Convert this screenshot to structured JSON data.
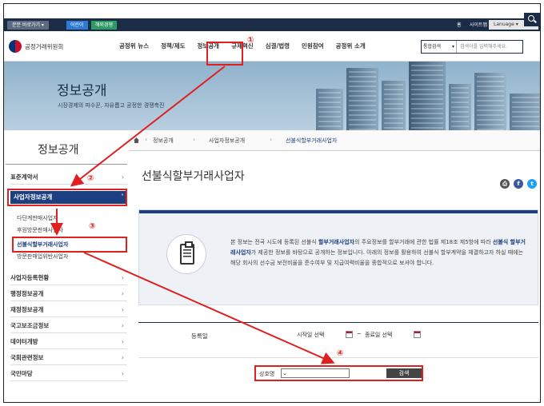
{
  "topbar": {
    "quick_label": "분문 바로가기 ▾",
    "kids": "어린이",
    "eco": "해외경쟁",
    "home": "홈",
    "sitemap": "사이트맵",
    "language": "Lanuage ▾"
  },
  "header": {
    "logo_text": "공정거래위원회",
    "nav": [
      "공정위 뉴스",
      "정책/제도",
      "정보공개",
      "규제혁신",
      "심결/법령",
      "민원참여",
      "공정위 소개"
    ],
    "search_scope": "통합검색",
    "search_placeholder": "검색어를 입력해주세요."
  },
  "banner": {
    "title": "정보공개",
    "subtitle": "시장경제의 파수꾼, 자유롭고 공정한 경쟁촉진"
  },
  "sidebar": {
    "title": "정보공개",
    "items": [
      {
        "label": "표준계약서"
      },
      {
        "label": "사업자정보공개"
      },
      {
        "label": "사업자등록현황"
      },
      {
        "label": "행정정보공개"
      },
      {
        "label": "재정정보공개"
      },
      {
        "label": "국고보조금정보"
      },
      {
        "label": "데이터개방"
      },
      {
        "label": "국회관련정보"
      },
      {
        "label": "국민마당"
      }
    ],
    "sub_items": [
      "다단계판매사업자",
      "후원방문판매사업자",
      "선불식할부거래사업자",
      "방문판매업위반사업자"
    ]
  },
  "breadcrumb": [
    "정보공개",
    "사업자정보공개",
    "선불식할부거래사업자"
  ],
  "content": {
    "title": "선불식할부거래사업자",
    "info_parts": [
      "본 정보는 전국 시도에 등록된 선불식 ",
      "할부거래사업자",
      "의 주요정보를 할부거래에 관한 법률 제18조 제5항에 따라 ",
      "선불식 할부거래사업자",
      "가 제공한 정보를 바탕으로 공개하는 정보입니다. 아래의 정보를 활용하여 선불식 할부계약을 체결하고자 하실 때에는 해당 회사의 선수금 보전비율을 준수여부 및 지급여력비율을 종합적으로 보셔야 합니다."
    ]
  },
  "form": {
    "reg_date_label": "등록일",
    "start_date": "시작일 선택",
    "end_date": "종료일 선택",
    "tilde": "~",
    "company_label": "상호명",
    "search_button": "검색"
  },
  "annotations": [
    "①",
    "②",
    "③",
    "④"
  ],
  "colors": {
    "annotation": "#e02020",
    "navy": "#1a2c46",
    "active": "#1c3f82"
  }
}
